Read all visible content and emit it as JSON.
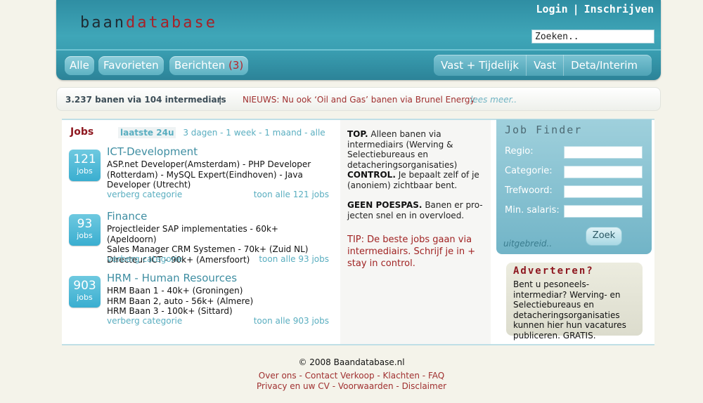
{
  "header": {
    "logo_part1": "baan",
    "logo_part2": "database",
    "login": "Login",
    "separator": "|",
    "register": "Inschrijven",
    "search_placeholder": "Zoeken..",
    "nav_left": [
      {
        "label": "Alle"
      },
      {
        "label": "Favorieten"
      },
      {
        "label": "Berichten",
        "count": "(3)"
      }
    ],
    "nav_right": [
      "Vast + Tijdelijk",
      "Vast",
      "Deta/Interim"
    ]
  },
  "newsbar": {
    "stats": "3.237 banen via 104 intermediars",
    "separator": "|",
    "news": "NIEUWS: Nu ook ‘Oil and Gas’ banen via Brunel Energy",
    "more": "lees meer.."
  },
  "jobs": {
    "title": "Jobs",
    "filter_active": "laatste 24u",
    "filter_rest": "3 dagen - 1 week - 1 maand - alle",
    "badge_label": "jobs",
    "hide_label": "verberg categorie",
    "categories": [
      {
        "count": "121",
        "title": "ICT-Development",
        "body": "ASP.net Developer(Amsterdam) - PHP Developer (Rotterdam) - MySQL Expert(Eindhoven) - Java Developer (Utrecht)",
        "show_all": "toon alle 121 jobs"
      },
      {
        "count": "93",
        "title": "Finance",
        "lines": [
          "Projectleider SAP implementaties - 60k+ (Apeldoorn)",
          "Sales Manager CRM Systemen - 70k+ (Zuid NL)",
          "Directeur ICT - 90k+ (Amersfoort)"
        ],
        "show_all": "toon alle 93 jobs"
      },
      {
        "count": "903",
        "title": "HRM - Human Resources",
        "lines": [
          "HRM Baan 1 - 40k+ (Groningen)",
          "HRM Baan 2, auto - 56k+ (Almere)",
          "HRM Baan 3 - 100k+ (Sittard)"
        ],
        "show_all": "toon alle 903 jobs"
      }
    ]
  },
  "mid": {
    "top_bold": "TOP.",
    "top_text": "Alleen banen via intermediairs (Werving & Selectiebureaus en detacheringsorganisaties)",
    "control_bold": "CONTROL.",
    "control_text": "Je bepaalt zelf of je (anoniem) zichtbaar bent.",
    "poespas_bold": "GEEN POESPAS.",
    "poespas_text": "Banen er pro-jecten snel en in overvloed.",
    "tip": "TIP: De beste jobs gaan via intermediairs. Schrijf je in + stay in control."
  },
  "finder": {
    "title": "Job Finder",
    "labels": [
      "Regio:",
      "Categorie:",
      "Trefwoord:",
      "Min. salaris:"
    ],
    "button": "Zoek",
    "advanced": "uitgebreid.."
  },
  "advert": {
    "title": "Adverteren?",
    "text": "Bent u pesoneels-intermediar? Werving- en Selectiebureaus en detacheringsorganisaties kunnen hier hun vacatures publiceren. GRATIS."
  },
  "footer": {
    "copyright": "© 2008 Baandatabase.nl",
    "links1": [
      "Over ons",
      "Contact Verkoop",
      "Klachten",
      "FAQ"
    ],
    "links2": [
      "Privacy en uw CV",
      "Voorwaarden",
      "Disclaimer"
    ],
    "sep": " - "
  },
  "colors": {
    "header_teal": "#3fa6b8",
    "brand_red": "#a62128",
    "link_teal": "#5aaec0",
    "badge_blue": "#3aaed0"
  }
}
